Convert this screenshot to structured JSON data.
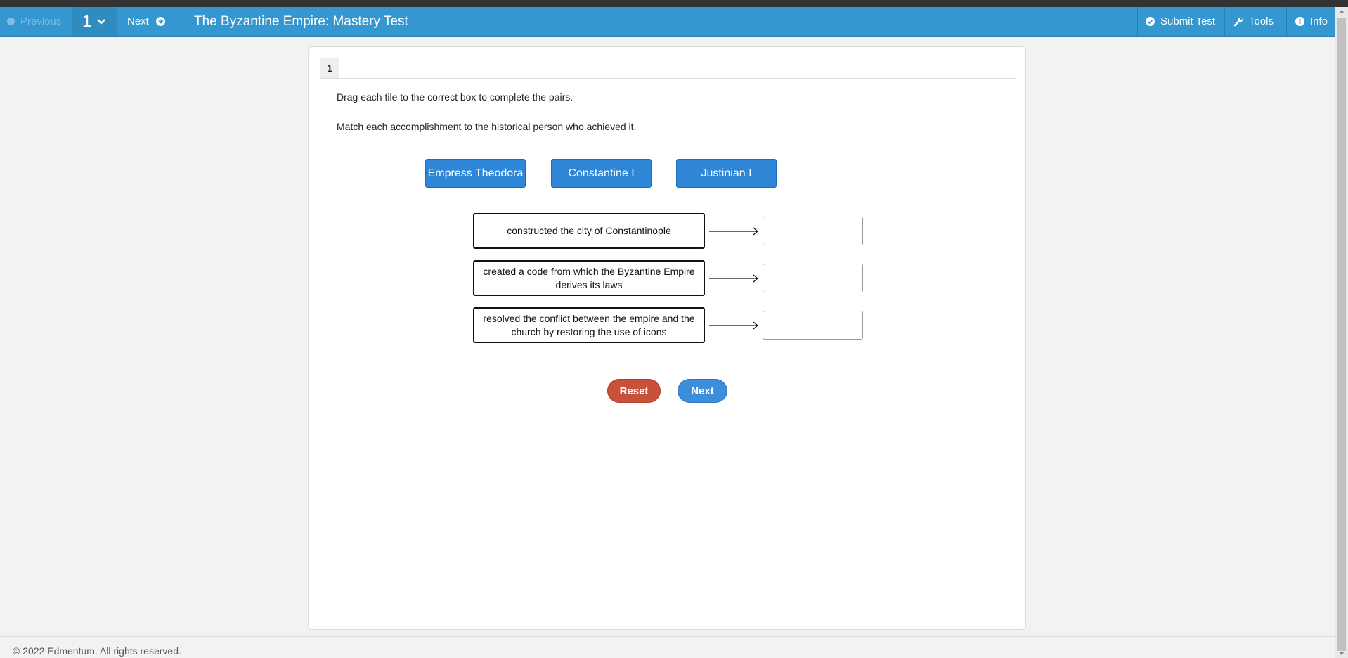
{
  "nav": {
    "previous_label": "Previous",
    "question_number": "1",
    "next_label": "Next",
    "title": "The Byzantine Empire: Mastery Test",
    "submit_label": "Submit Test",
    "tools_label": "Tools",
    "info_label": "Info"
  },
  "question": {
    "tab_number": "1",
    "instruction_1": "Drag each tile to the correct box to complete the pairs.",
    "instruction_2": "Match each accomplishment to the historical person who achieved it.",
    "tiles": [
      "Empress Theodora",
      "Constantine I",
      "Justinian I"
    ],
    "prompts": [
      "constructed the city of Constantinople",
      "created a code from which the Byzantine Empire derives its laws",
      "resolved the conflict between the empire and the church by restoring the use of icons"
    ],
    "reset_label": "Reset",
    "next_label": "Next"
  },
  "footer": {
    "copyright": "© 2022 Edmentum. All rights reserved."
  },
  "colors": {
    "navbar": "#3497cf",
    "tile": "#2f85d6",
    "reset": "#c9513a",
    "next": "#3a8edb"
  }
}
